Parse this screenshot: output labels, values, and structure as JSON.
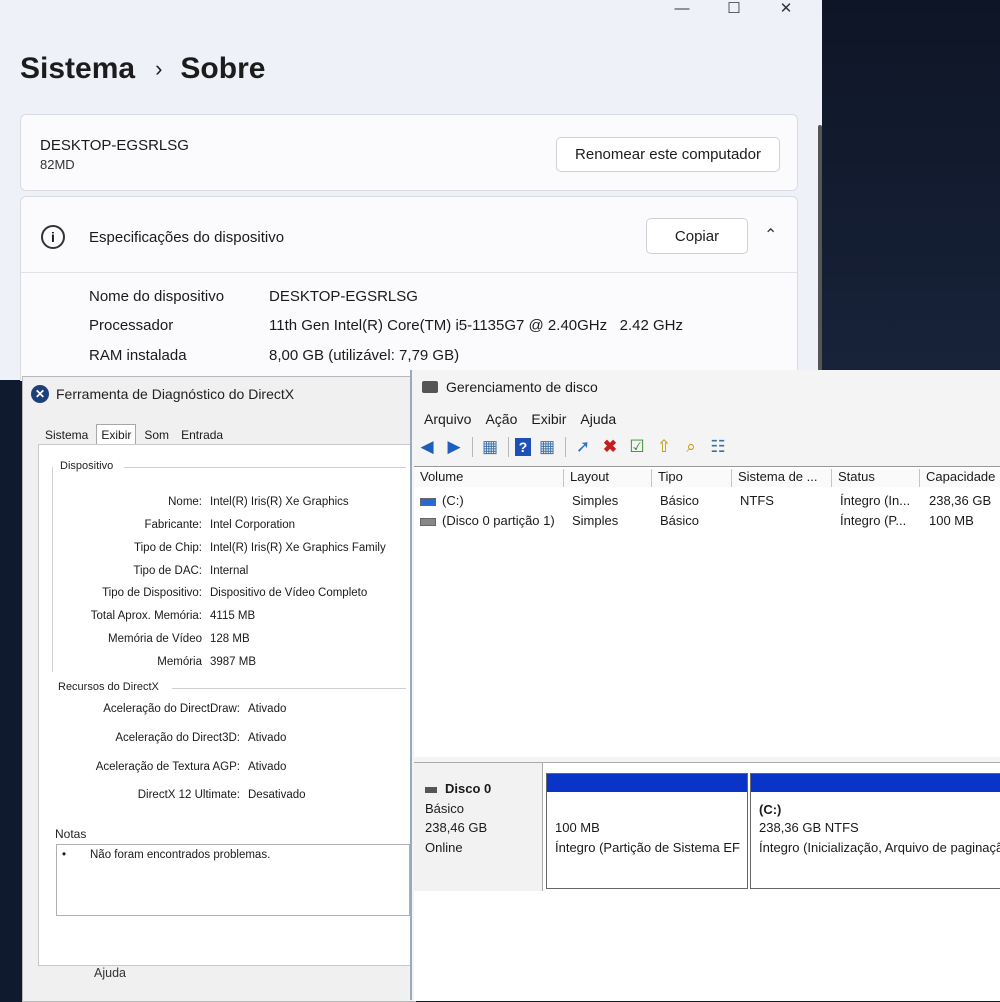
{
  "settings": {
    "breadcrumb": {
      "parent": "Sistema",
      "separator": "›",
      "current": "Sobre"
    },
    "caption": {
      "minimize": "—",
      "maximize": "☐",
      "close": "✕"
    },
    "device_card": {
      "name": "DESKTOP-EGSRLSG",
      "model": "82MD",
      "rename_button": "Renomear este computador"
    },
    "specs": {
      "title": "Especificações do dispositivo",
      "copy_button": "Copiar",
      "rows": [
        {
          "label": "Nome do dispositivo",
          "value": "DESKTOP-EGSRLSG"
        },
        {
          "label": "Processador",
          "value": "11th Gen Intel(R) Core(TM) i5-1135G7 @ 2.40GHz   2.42 GHz"
        },
        {
          "label": "RAM instalada",
          "value": "8,00 GB (utilizável: 7,79 GB)"
        }
      ]
    }
  },
  "dxdiag": {
    "title": "Ferramenta de Diagnóstico do DirectX",
    "tabs": [
      "Sistema",
      "Exibir",
      "Som",
      "Entrada"
    ],
    "active_tab": "Exibir",
    "device_group": "Dispositivo",
    "device": [
      {
        "label": "Nome:",
        "value": "Intel(R) Iris(R) Xe Graphics"
      },
      {
        "label": "Fabricante:",
        "value": "Intel Corporation"
      },
      {
        "label": "Tipo de Chip:",
        "value": "Intel(R) Iris(R) Xe Graphics Family"
      },
      {
        "label": "Tipo de DAC:",
        "value": "Internal"
      },
      {
        "label": "Tipo de Dispositivo:",
        "value": "Dispositivo de Vídeo Completo"
      },
      {
        "label": "Total Aprox. Memória:",
        "value": "4115 MB"
      },
      {
        "label": "Memória de Vídeo",
        "value": "128 MB"
      },
      {
        "label": "Memória",
        "value": "3987 MB"
      }
    ],
    "features_group": "Recursos do DirectX",
    "features": [
      {
        "label": "Aceleração do DirectDraw:",
        "value": "Ativado"
      },
      {
        "label": "Aceleração do Direct3D:",
        "value": "Ativado"
      },
      {
        "label": "Aceleração de Textura AGP:",
        "value": "Ativado"
      },
      {
        "label": "DirectX 12 Ultimate:",
        "value": "Desativado"
      }
    ],
    "notes_label": "Notas",
    "notes": [
      "Não foram encontrados problemas."
    ],
    "help_button": "Ajuda"
  },
  "diskmgmt": {
    "title": "Gerenciamento de disco",
    "menu": [
      "Arquivo",
      "Ação",
      "Exibir",
      "Ajuda"
    ],
    "columns": [
      "Volume",
      "Layout",
      "Tipo",
      "Sistema de ...",
      "Status",
      "Capacidade"
    ],
    "volumes": [
      {
        "volume": "(C:)",
        "layout": "Simples",
        "tipo": "Básico",
        "sistema": "NTFS",
        "status": "Íntegro (In...",
        "capacidade": "238,36 GB"
      },
      {
        "volume": "(Disco 0 partição 1)",
        "layout": "Simples",
        "tipo": "Básico",
        "sistema": "",
        "status": "Íntegro (P...",
        "capacidade": "100 MB"
      }
    ],
    "disk": {
      "name": "Disco 0",
      "type": "Básico",
      "size": "238,46 GB",
      "state": "Online"
    },
    "partitions": [
      {
        "label": "",
        "size": "100 MB",
        "status": "Íntegro (Partição de Sistema EFI)"
      },
      {
        "label": "(C:)",
        "size": "238,36 GB NTFS",
        "status": "Íntegro (Inicialização, Arquivo de paginação)"
      }
    ],
    "accent_color": "#0a34c8"
  }
}
